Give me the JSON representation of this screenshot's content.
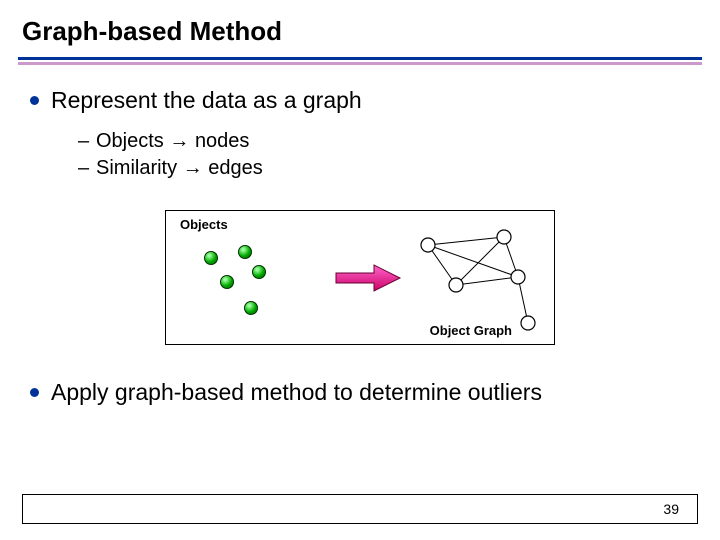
{
  "title": "Graph-based Method",
  "bullets": [
    {
      "text": "Represent the data as a graph"
    },
    {
      "text": "Apply graph-based method to determine outliers"
    }
  ],
  "sub_bullets": [
    {
      "label": "Objects",
      "arrow": "→",
      "target": "nodes"
    },
    {
      "label": "Similarity",
      "arrow": "→",
      "target": "edges"
    }
  ],
  "diagram": {
    "objects_label": "Objects",
    "graph_label": "Object Graph"
  },
  "page_number": "39"
}
